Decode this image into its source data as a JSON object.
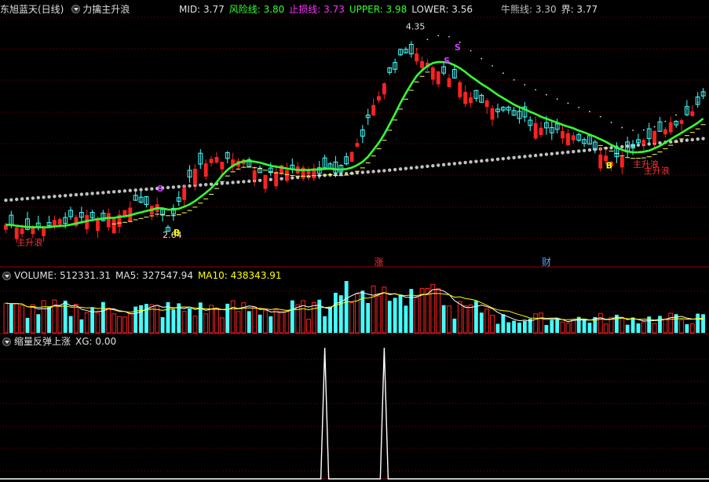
{
  "main_header": {
    "title": "东旭蓝天(日线)",
    "indicator": "力擒主升浪",
    "params": [
      {
        "label": "MID: 3.77",
        "color": "#e0e0e0"
      },
      {
        "label": "风险线: 3.80",
        "color": "#33ff33"
      },
      {
        "label": "止损线: 3.73",
        "color": "#ff33ff"
      },
      {
        "label": "UPPER: 3.98",
        "color": "#33ff33"
      },
      {
        "label": "LOWER: 3.56",
        "color": "#e0e0e0"
      }
    ],
    "params_right": [
      {
        "label": "牛熊线: 3.30",
        "color": "#c0c0c0"
      },
      {
        "label": "界: 3.77",
        "color": "#e0e0e0"
      }
    ]
  },
  "volume_header": {
    "params": [
      {
        "label": "VOLUME: 512331.31",
        "color": "#e0e0e0"
      },
      {
        "label": "MA5: 327547.94",
        "color": "#e0e0e0"
      },
      {
        "label": "MA10: 438343.91",
        "color": "#ffff00"
      }
    ]
  },
  "signal_header": {
    "params": [
      {
        "label": "缩量反弹上涨",
        "color": "#e0e0e0"
      },
      {
        "label": "XG: 0.00",
        "color": "#e0e0e0"
      }
    ]
  },
  "colors": {
    "up": "#ff2222",
    "down": "#44ffff",
    "mid": "#33ff33",
    "stop": "#ffff66",
    "bull": "#c0c0c0",
    "grid": "#8b0000"
  },
  "chart_data": [
    {
      "type": "candlestick",
      "panel": "price",
      "ylim": [
        2.5,
        4.45
      ],
      "n_bars": 130,
      "annotations": [
        {
          "text": "4.35",
          "bar": 74,
          "value": 4.35
        },
        {
          "text": "2.64",
          "bar": 29,
          "value": 2.64
        },
        {
          "text": "S",
          "bar": 28,
          "value": 3.02,
          "color": "#cc44ff"
        },
        {
          "text": "B",
          "bar": 31,
          "value": 2.66,
          "color": "#ffff00"
        },
        {
          "text": "S",
          "bar": 81,
          "value": 4.07,
          "color": "#cc44ff"
        },
        {
          "text": "S",
          "bar": 83,
          "value": 4.18,
          "color": "#cc44ff"
        },
        {
          "text": "B",
          "bar": 111,
          "value": 3.21,
          "color": "#ffff00"
        },
        {
          "text": "主升浪",
          "bar": 2,
          "value": 2.58,
          "color": "#ff3333"
        },
        {
          "text": "主升浪",
          "bar": 118,
          "value": 3.17,
          "color": "#ff3333"
        },
        {
          "text": "主升浪",
          "bar": 116,
          "value": 3.22,
          "color": "#ff3333"
        }
      ],
      "markers": [
        {
          "text": "涨",
          "bar": 69,
          "color": "#ff3333"
        },
        {
          "text": "财",
          "bar": 100,
          "color": "#44aaff"
        }
      ]
    },
    {
      "type": "bar",
      "panel": "volume",
      "series": [
        "VOLUME",
        "MA5",
        "MA10"
      ]
    },
    {
      "type": "line",
      "panel": "signal",
      "series": [
        {
          "name": "XG",
          "spikes_at_bars": [
            59,
            70
          ],
          "values_at_spikes": [
            1,
            1
          ]
        }
      ],
      "ylim": [
        0,
        1
      ]
    }
  ]
}
